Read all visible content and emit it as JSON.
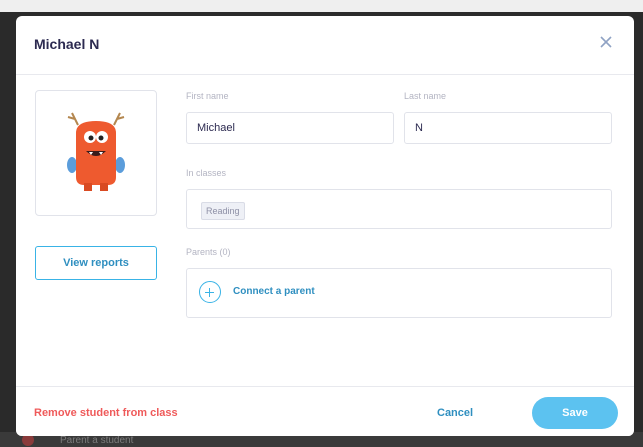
{
  "modal": {
    "title": "Michael N"
  },
  "avatar": {
    "icon": "monster-avatar-icon"
  },
  "actions": {
    "view_reports": "View reports"
  },
  "form": {
    "first_name": {
      "label": "First name",
      "value": "Michael"
    },
    "last_name": {
      "label": "Last name",
      "value": "N"
    },
    "classes": {
      "label": "In classes",
      "items": [
        "Reading"
      ]
    },
    "parents": {
      "label": "Parents (0)",
      "connect_label": "Connect a parent"
    }
  },
  "footer": {
    "remove_label": "Remove student from class",
    "cancel_label": "Cancel",
    "save_label": "Save"
  },
  "background": {
    "row_text": "Parent a student"
  },
  "colors": {
    "accent": "#39b3e6",
    "danger": "#ef5a5a",
    "title": "#2c2a50"
  }
}
